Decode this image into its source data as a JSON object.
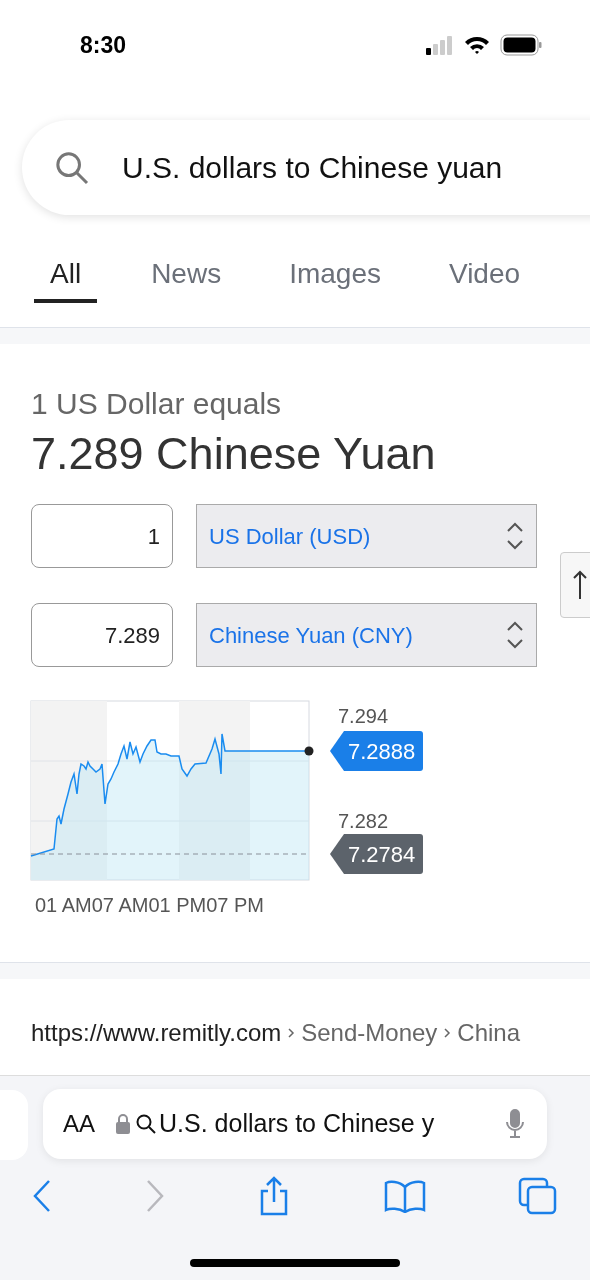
{
  "status_bar": {
    "time": "8:30"
  },
  "search": {
    "value": "U.S. dollars to Chinese yuan"
  },
  "tabs": [
    {
      "label": "All",
      "selected": true
    },
    {
      "label": "News",
      "selected": false
    },
    {
      "label": "Images",
      "selected": false
    },
    {
      "label": "Video",
      "selected": false
    }
  ],
  "converter": {
    "caption": "1 US Dollar equals",
    "result": "7.289 Chinese Yuan",
    "rows": [
      {
        "amount": "1",
        "currency": "US Dollar (USD)"
      },
      {
        "amount": "7.289",
        "currency": "Chinese Yuan (CNY)"
      }
    ],
    "chart": {
      "y_labels": [
        "7.294",
        "7.282"
      ],
      "price_tags": [
        {
          "kind": "current",
          "label": "7.2888"
        },
        {
          "kind": "open",
          "label": "7.2784"
        }
      ],
      "time_labels": [
        "01 AM",
        "07 AM",
        "01 PM",
        "07 PM"
      ]
    }
  },
  "result_link": {
    "url": "https://www.remitly.com",
    "path": [
      "Send-Money",
      "China"
    ]
  },
  "address_bar": {
    "text_size": "AA",
    "value": "U.S. dollars to Chinese y"
  }
}
